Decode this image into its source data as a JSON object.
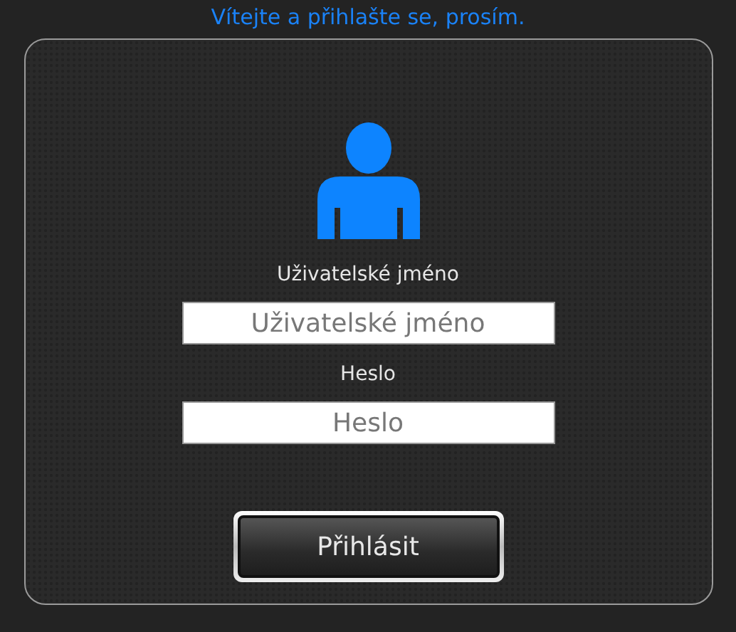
{
  "heading": "Vítejte a přihlašte se, prosím.",
  "username": {
    "label": "Uživatelské jméno",
    "placeholder": "Uživatelské jméno"
  },
  "password": {
    "label": "Heslo",
    "placeholder": "Heslo"
  },
  "submit_button": "Přihlásit"
}
